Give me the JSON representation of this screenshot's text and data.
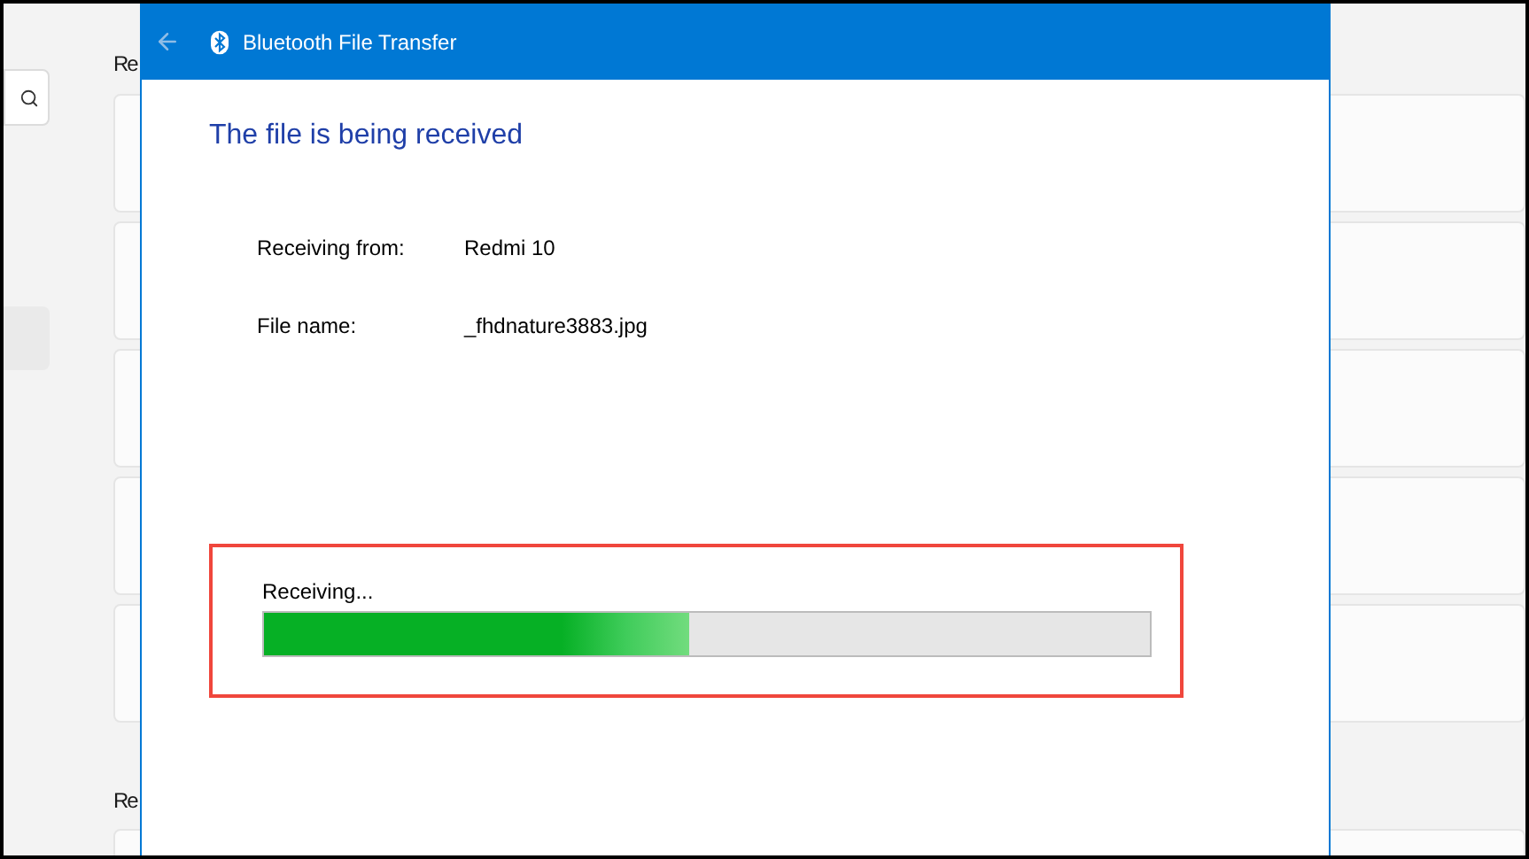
{
  "window": {
    "title": "Bluetooth File Transfer"
  },
  "background": {
    "headings": [
      "Re",
      "Re"
    ]
  },
  "heading": "The file is being received",
  "details": [
    {
      "label": "Receiving from:",
      "value": "Redmi 10"
    },
    {
      "label": "File name:",
      "value": "_fhdnature3883.jpg"
    }
  ],
  "progress": {
    "label": "Receiving...",
    "level": 0.48
  }
}
